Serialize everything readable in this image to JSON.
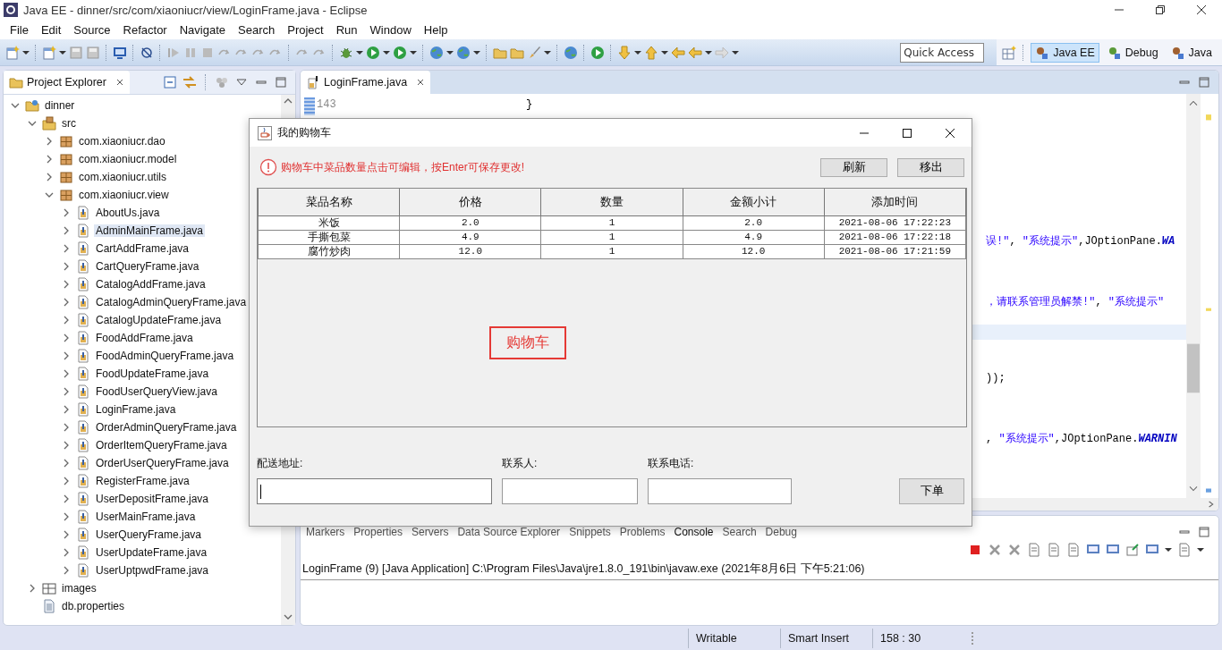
{
  "window": {
    "title": "Java EE - dinner/src/com/xiaoniucr/view/LoginFrame.java - Eclipse"
  },
  "menu": [
    "File",
    "Edit",
    "Source",
    "Refactor",
    "Navigate",
    "Search",
    "Project",
    "Run",
    "Window",
    "Help"
  ],
  "quick_access": {
    "placeholder": "Quick Access"
  },
  "perspectives": [
    {
      "label": "Java EE",
      "selected": true
    },
    {
      "label": "Debug",
      "selected": false
    },
    {
      "label": "Java",
      "selected": false
    }
  ],
  "project_explorer": {
    "title": "Project Explorer",
    "tree": [
      {
        "label": "dinner",
        "kind": "project",
        "expanded": true,
        "selected": false,
        "children": [
          {
            "label": "src",
            "kind": "source",
            "expanded": true,
            "selected": false,
            "children": [
              {
                "label": "com.xiaoniucr.dao",
                "kind": "package",
                "expanded": false,
                "selected": false
              },
              {
                "label": "com.xiaoniucr.model",
                "kind": "package",
                "expanded": false,
                "selected": false
              },
              {
                "label": "com.xiaoniucr.utils",
                "kind": "package",
                "expanded": false,
                "selected": false
              },
              {
                "label": "com.xiaoniucr.view",
                "kind": "package",
                "expanded": true,
                "selected": false,
                "children": [
                  {
                    "label": "AboutUs.java",
                    "kind": "java",
                    "expanded": false,
                    "selected": false
                  },
                  {
                    "label": "AdminMainFrame.java",
                    "kind": "java",
                    "expanded": false,
                    "selected": true
                  },
                  {
                    "label": "CartAddFrame.java",
                    "kind": "java",
                    "expanded": false,
                    "selected": false
                  },
                  {
                    "label": "CartQueryFrame.java",
                    "kind": "java",
                    "expanded": false,
                    "selected": false
                  },
                  {
                    "label": "CatalogAddFrame.java",
                    "kind": "java",
                    "expanded": false,
                    "selected": false
                  },
                  {
                    "label": "CatalogAdminQueryFrame.java",
                    "kind": "java",
                    "expanded": false,
                    "selected": false
                  },
                  {
                    "label": "CatalogUpdateFrame.java",
                    "kind": "java",
                    "expanded": false,
                    "selected": false
                  },
                  {
                    "label": "FoodAddFrame.java",
                    "kind": "java",
                    "expanded": false,
                    "selected": false
                  },
                  {
                    "label": "FoodAdminQueryFrame.java",
                    "kind": "java",
                    "expanded": false,
                    "selected": false
                  },
                  {
                    "label": "FoodUpdateFrame.java",
                    "kind": "java",
                    "expanded": false,
                    "selected": false
                  },
                  {
                    "label": "FoodUserQueryView.java",
                    "kind": "java",
                    "expanded": false,
                    "selected": false
                  },
                  {
                    "label": "LoginFrame.java",
                    "kind": "java",
                    "expanded": false,
                    "selected": false
                  },
                  {
                    "label": "OrderAdminQueryFrame.java",
                    "kind": "java",
                    "expanded": false,
                    "selected": false
                  },
                  {
                    "label": "OrderItemQueryFrame.java",
                    "kind": "java",
                    "expanded": false,
                    "selected": false
                  },
                  {
                    "label": "OrderUserQueryFrame.java",
                    "kind": "java",
                    "expanded": false,
                    "selected": false
                  },
                  {
                    "label": "RegisterFrame.java",
                    "kind": "java",
                    "expanded": false,
                    "selected": false
                  },
                  {
                    "label": "UserDepositFrame.java",
                    "kind": "java",
                    "expanded": false,
                    "selected": false
                  },
                  {
                    "label": "UserMainFrame.java",
                    "kind": "java",
                    "expanded": false,
                    "selected": false
                  },
                  {
                    "label": "UserQueryFrame.java",
                    "kind": "java",
                    "expanded": false,
                    "selected": false
                  },
                  {
                    "label": "UserUpdateFrame.java",
                    "kind": "java",
                    "expanded": false,
                    "selected": false
                  },
                  {
                    "label": "UserUptpwdFrame.java",
                    "kind": "java",
                    "expanded": false,
                    "selected": false
                  }
                ]
              }
            ]
          },
          {
            "label": "images",
            "kind": "folder",
            "expanded": false,
            "selected": false
          },
          {
            "label": "db.properties",
            "kind": "properties",
            "selected": false
          }
        ]
      }
    ]
  },
  "editor": {
    "tab": "LoginFrame.java",
    "line_number": "143",
    "code_lines": [
      [
        {
          "text": "}",
          "kind": "plain"
        }
      ],
      [
        {
          "text": "误!\"",
          "kind": "string"
        },
        {
          "text": ", ",
          "kind": "plain"
        },
        {
          "text": "\"系统提示\"",
          "kind": "string"
        },
        {
          "text": ",JOptionPane.",
          "kind": "plain"
        },
        {
          "text": "WA",
          "kind": "constant"
        }
      ],
      [
        {
          "text": "，请联系管理员解禁!\"",
          "kind": "string"
        },
        {
          "text": ", ",
          "kind": "plain"
        },
        {
          "text": "\"系统提示\"",
          "kind": "string"
        }
      ],
      [
        {
          "text": "));",
          "kind": "plain"
        }
      ],
      [
        {
          "text": ", ",
          "kind": "plain"
        },
        {
          "text": "\"系统提示\"",
          "kind": "string"
        },
        {
          "text": ",JOptionPane.",
          "kind": "plain"
        },
        {
          "text": "WARNIN",
          "kind": "constant"
        }
      ]
    ]
  },
  "console": {
    "tabs": [
      {
        "label": "Markers",
        "selected": false
      },
      {
        "label": "Properties",
        "selected": false
      },
      {
        "label": "Servers",
        "selected": false
      },
      {
        "label": "Data Source Explorer",
        "selected": false
      },
      {
        "label": "Snippets",
        "selected": false
      },
      {
        "label": "Problems",
        "selected": false
      },
      {
        "label": "Console",
        "selected": true
      },
      {
        "label": "Search",
        "selected": false
      },
      {
        "label": "Debug",
        "selected": false
      }
    ],
    "launch": "LoginFrame (9) [Java Application] C:\\Program Files\\Java\\jre1.8.0_191\\bin\\javaw.exe (2021年8月6日 下午5:21:06)"
  },
  "status_bar": [
    "Writable",
    "Smart Insert",
    "158 : 30"
  ],
  "dialog": {
    "title": "我的购物车",
    "hint": "购物车中菜品数量点击可编辑，按Enter可保存更改!",
    "buttons": [
      "刷新",
      "移出"
    ],
    "table": {
      "columns": [
        "菜品名称",
        "价格",
        "数量",
        "金额小计",
        "添加时间"
      ],
      "rows": [
        [
          "米饭",
          "2.0",
          "1",
          "2.0",
          "2021-08-06 17:22:23"
        ],
        [
          "手撕包菜",
          "4.9",
          "1",
          "4.9",
          "2021-08-06 17:22:18"
        ],
        [
          "腐竹炒肉",
          "12.0",
          "1",
          "12.0",
          "2021-08-06 17:21:59"
        ]
      ]
    },
    "caption": "购物车",
    "fields": [
      {
        "label": "配送地址:",
        "focused": true
      },
      {
        "label": "联系人:",
        "focused": false
      },
      {
        "label": "联系电话:",
        "focused": false
      }
    ],
    "submit": "下单"
  }
}
